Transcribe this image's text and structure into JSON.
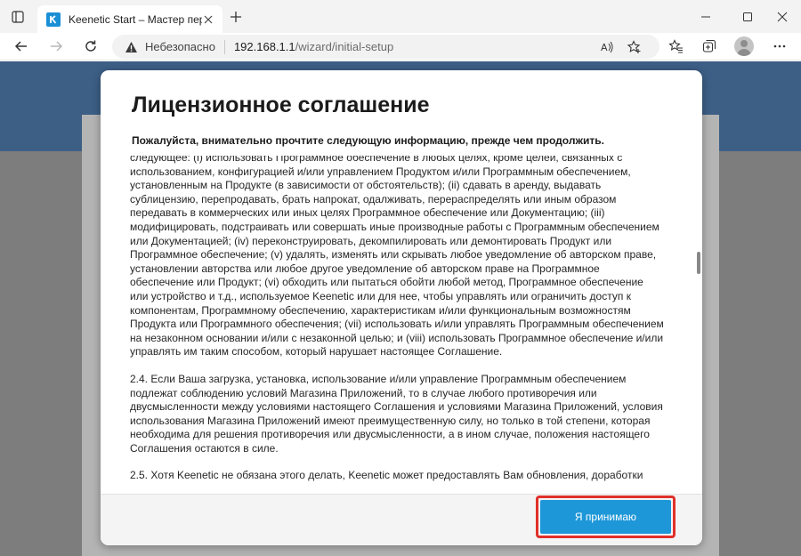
{
  "browser": {
    "tab": {
      "title": "Keenetic Start – Мастер первоначальной настройки"
    },
    "address_bar": {
      "security_label": "Небезопасно",
      "url_host": "192.168.1.1",
      "url_path": "/wizard/initial-setup"
    },
    "icons": {
      "tab_actions": "tab-actions-icon",
      "favicon": "keenetic-k-icon",
      "close": "close-icon",
      "new_tab": "plus-icon",
      "minimize": "minimize-icon",
      "maximize": "maximize-icon",
      "close_window": "close-window-icon",
      "back": "back-arrow-icon",
      "forward": "forward-arrow-icon",
      "refresh": "refresh-icon",
      "warning": "warning-triangle-icon",
      "read_aloud": "read-aloud-icon",
      "favorite": "star-plus-icon",
      "favorites": "favorites-icon",
      "collections": "collections-icon",
      "profile": "profile-avatar",
      "more": "more-dots-icon"
    }
  },
  "modal": {
    "title": "Лицензионное соглашение",
    "subtitle": "Пожалуйста, внимательно прочтите следующую информацию, прежде чем продолжить.",
    "paragraphs": [
      "следующее: (i) использовать Программное обеспечение в любых целях, кроме целей, связанных с использованием, конфигурацией и/или управлением Продуктом и/или Программным обеспечением, установленным на Продукте (в зависимости от обстоятельств); (ii) сдавать в аренду, выдавать сублицензию, перепродавать, брать напрокат, одалживать, перераспределять или иным образом передавать в коммерческих или иных целях Программное обеспечение или Документацию; (iii) модифицировать, подстраивать или совершать иные производные работы с Программным обеспечением или Документацией; (iv) переконструировать, декомпилировать или демонтировать Продукт или Программное обеспечение; (v) удалять, изменять или скрывать любое уведомление об авторском праве, установлении авторства или любое другое уведомление об авторском праве на Программное обеспечение или Продукт; (vi) обходить или пытаться обойти любой метод, Программное обеспечение или устройство и т.д., используемое Keenetic или для нее, чтобы управлять или ограничить доступ к компонентам, Программному обеспечению, характеристикам и/или функциональным возможностям Продукта или Программного обеспечения; (vii) использовать и/или управлять Программным обеспечением на незаконном основании и/или с незаконной целью; и (viii) использовать Программное обеспечение и/или управлять им таким способом, который нарушает настоящее Соглашение.",
      "2.4. Если Ваша загрузка, установка, использование и/или управление Программным обеспечением подлежат соблюдению условий Магазина Приложений, то в случае любого противоречия или двусмысленности между условиями настоящего Соглашения и условиями Магазина Приложений, условия использования Магазина Приложений имеют преимущественную силу, но только в той степени, которая необходима для решения противоречия или двусмысленности, а в ином случае, положения настоящего Соглашения остаются в силе.",
      "2.5. Хотя Keenetic не обязана этого делать, Keenetic может предоставлять Вам обновления, доработки"
    ],
    "accept_label": "Я принимаю"
  }
}
